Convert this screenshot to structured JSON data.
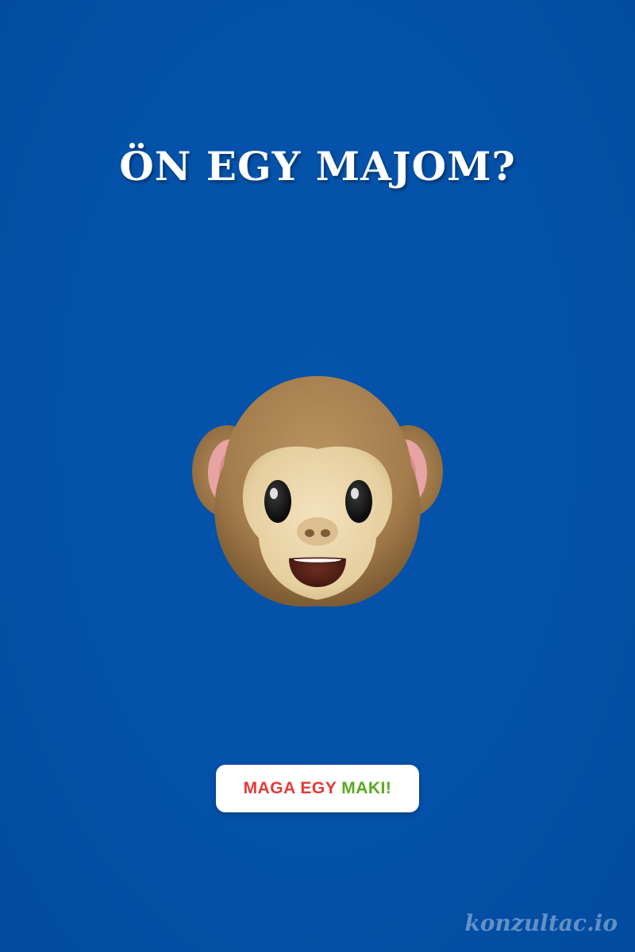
{
  "headline": "ÖN EGY MAJOM?",
  "illustration": {
    "icon": "monkey-face-icon"
  },
  "button": {
    "part1": "MAGA EGY",
    "part2": "MAKI!",
    "part1_color": "#e23a37",
    "part2_color": "#58a81f"
  },
  "watermark": "konzultac.io",
  "colors": {
    "background": "#0351a8",
    "headline": "#ffffff",
    "button_bg": "#ffffff"
  }
}
